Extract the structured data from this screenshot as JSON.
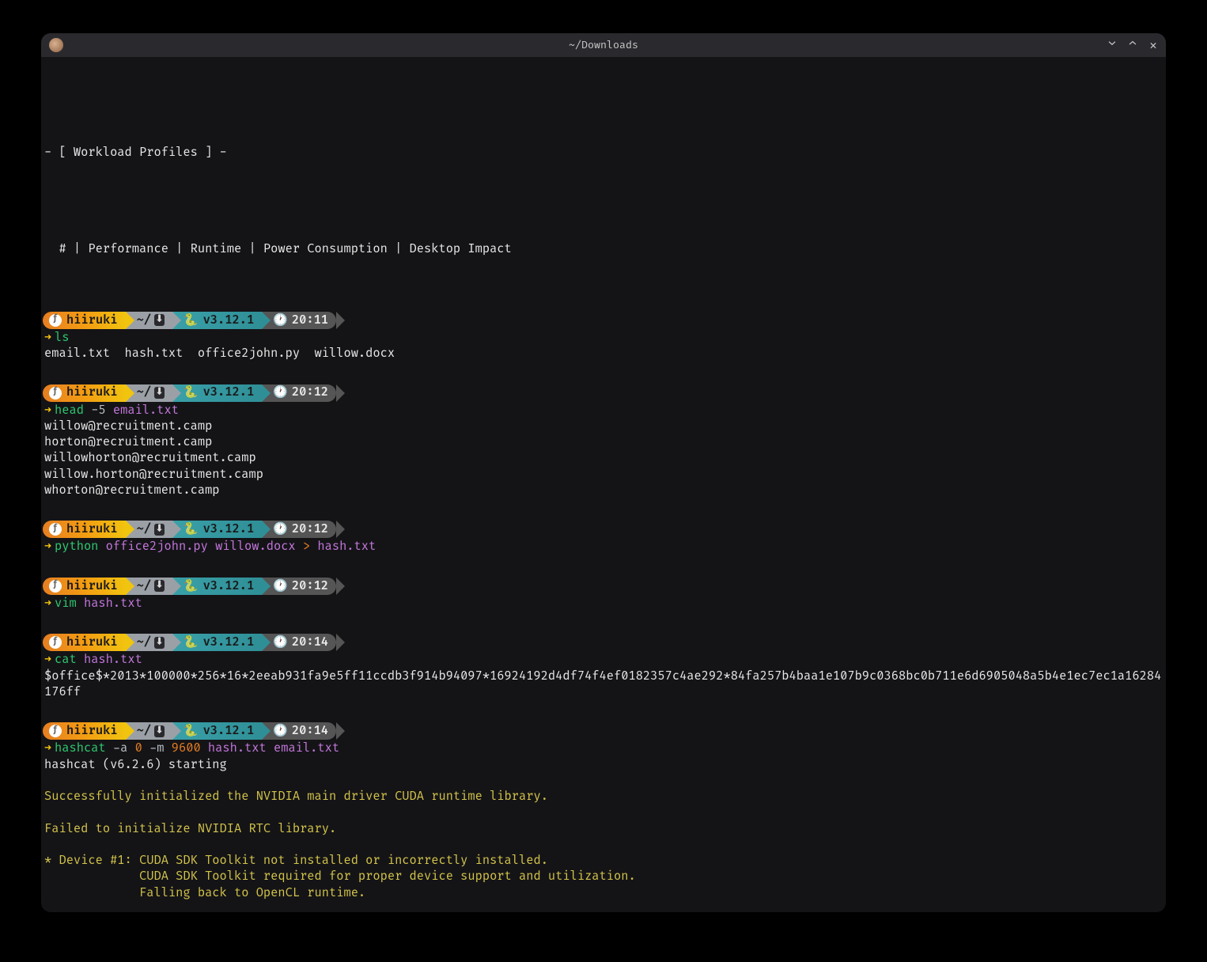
{
  "window": {
    "title": "~/Downloads"
  },
  "header": {
    "line1": "- [ Workload Profiles ] -",
    "line2": "  # | Performance | Runtime | Power Consumption | Desktop Impact"
  },
  "prompt": {
    "user": "hiiruki",
    "path": "~/",
    "py": "v3.12.1"
  },
  "blocks": [
    {
      "time": "20:11",
      "cmd": [
        {
          "t": "ls",
          "c": "green"
        }
      ],
      "out": [
        {
          "t": "email.txt  hash.txt  office2john.py  willow.docx"
        }
      ]
    },
    {
      "time": "20:12",
      "cmd": [
        {
          "t": "head ",
          "c": "green"
        },
        {
          "t": "-5 ",
          "c": "grey"
        },
        {
          "t": "email.txt",
          "c": "purple"
        }
      ],
      "out": [
        {
          "t": "willow@recruitment.camp"
        },
        {
          "t": "horton@recruitment.camp"
        },
        {
          "t": "willowhorton@recruitment.camp"
        },
        {
          "t": "willow.horton@recruitment.camp"
        },
        {
          "t": "whorton@recruitment.camp"
        }
      ]
    },
    {
      "time": "20:12",
      "cmd": [
        {
          "t": "python ",
          "c": "green"
        },
        {
          "t": "office2john.py ",
          "c": "purple"
        },
        {
          "t": "willow.docx ",
          "c": "purple"
        },
        {
          "t": "> ",
          "c": "orange"
        },
        {
          "t": "hash.txt",
          "c": "purple"
        }
      ],
      "out": []
    },
    {
      "time": "20:12",
      "cmd": [
        {
          "t": "vim ",
          "c": "green"
        },
        {
          "t": "hash.txt",
          "c": "purple"
        }
      ],
      "out": []
    },
    {
      "time": "20:14",
      "cmd": [
        {
          "t": "cat ",
          "c": "green"
        },
        {
          "t": "hash.txt",
          "c": "purple"
        }
      ],
      "out": [
        {
          "t": "$office$*2013*100000*256*16*2eeab931fa9e5ff11ccdb3f914b94097*16924192d4df74f4ef0182357c4ae292*84fa257b4baa1e107b9c0368bc0b711e6d6905048a5b4e1ec7ec1a16284176ff",
          "wrap": true
        }
      ]
    },
    {
      "time": "20:14",
      "cmd": [
        {
          "t": "hashcat ",
          "c": "green"
        },
        {
          "t": "-a ",
          "c": "grey"
        },
        {
          "t": "0 ",
          "c": "orange"
        },
        {
          "t": "-m ",
          "c": "grey"
        },
        {
          "t": "9600 ",
          "c": "orange"
        },
        {
          "t": "hash.txt ",
          "c": "purple"
        },
        {
          "t": "email.txt",
          "c": "purple"
        }
      ],
      "out": [
        {
          "t": "hashcat (v6.2.6) starting"
        },
        {
          "t": ""
        },
        {
          "t": "Successfully initialized the NVIDIA main driver CUDA runtime library.",
          "c": "warn"
        },
        {
          "t": ""
        },
        {
          "t": "Failed to initialize NVIDIA RTC library.",
          "c": "warn"
        },
        {
          "t": ""
        },
        {
          "t": "* Device #1: CUDA SDK Toolkit not installed or incorrectly installed.",
          "c": "warn"
        },
        {
          "t": "             CUDA SDK Toolkit required for proper device support and utilization.",
          "c": "warn"
        },
        {
          "t": "             Falling back to OpenCL runtime.",
          "c": "warn"
        }
      ]
    }
  ]
}
